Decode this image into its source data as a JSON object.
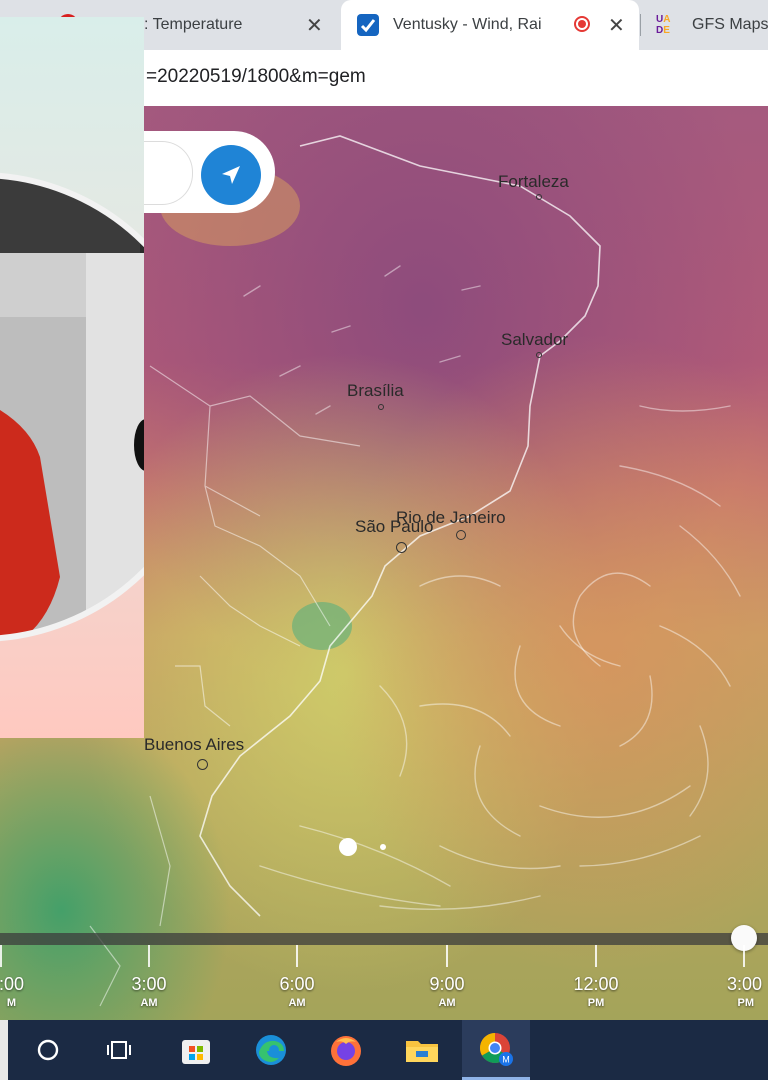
{
  "browser": {
    "tabs": [
      {
        "title": ": Temperature",
        "active": false,
        "close": "✕"
      },
      {
        "title": "Ventusky - Wind, Rai",
        "active": true,
        "close": "✕"
      },
      {
        "title": "GFS Maps",
        "active": false
      }
    ],
    "url": "=20220519/1800&m=gem"
  },
  "map": {
    "cities": [
      {
        "name": "Fortaleza"
      },
      {
        "name": "Salvador"
      },
      {
        "name": "Brasília"
      },
      {
        "name": "Rio de Janeiro"
      },
      {
        "name": "São Paulo"
      },
      {
        "name": "Buenos Aires"
      }
    ]
  },
  "timeline": {
    "ticks": [
      {
        "time": ":00",
        "ampm": "M"
      },
      {
        "time": "3:00",
        "ampm": "AM"
      },
      {
        "time": "6:00",
        "ampm": "AM"
      },
      {
        "time": "9:00",
        "ampm": "AM"
      },
      {
        "time": "12:00",
        "ampm": "PM"
      },
      {
        "time": "3:00",
        "ampm": "PM"
      }
    ]
  },
  "taskbar": {
    "items": [
      "search-circle-icon",
      "task-view-icon",
      "store-icon",
      "edge-icon",
      "firefox-icon",
      "file-explorer-icon",
      "chrome-icon"
    ]
  },
  "colors": {
    "locate_button": "#1f84d6",
    "taskbar_bg": "#1b2a44"
  }
}
